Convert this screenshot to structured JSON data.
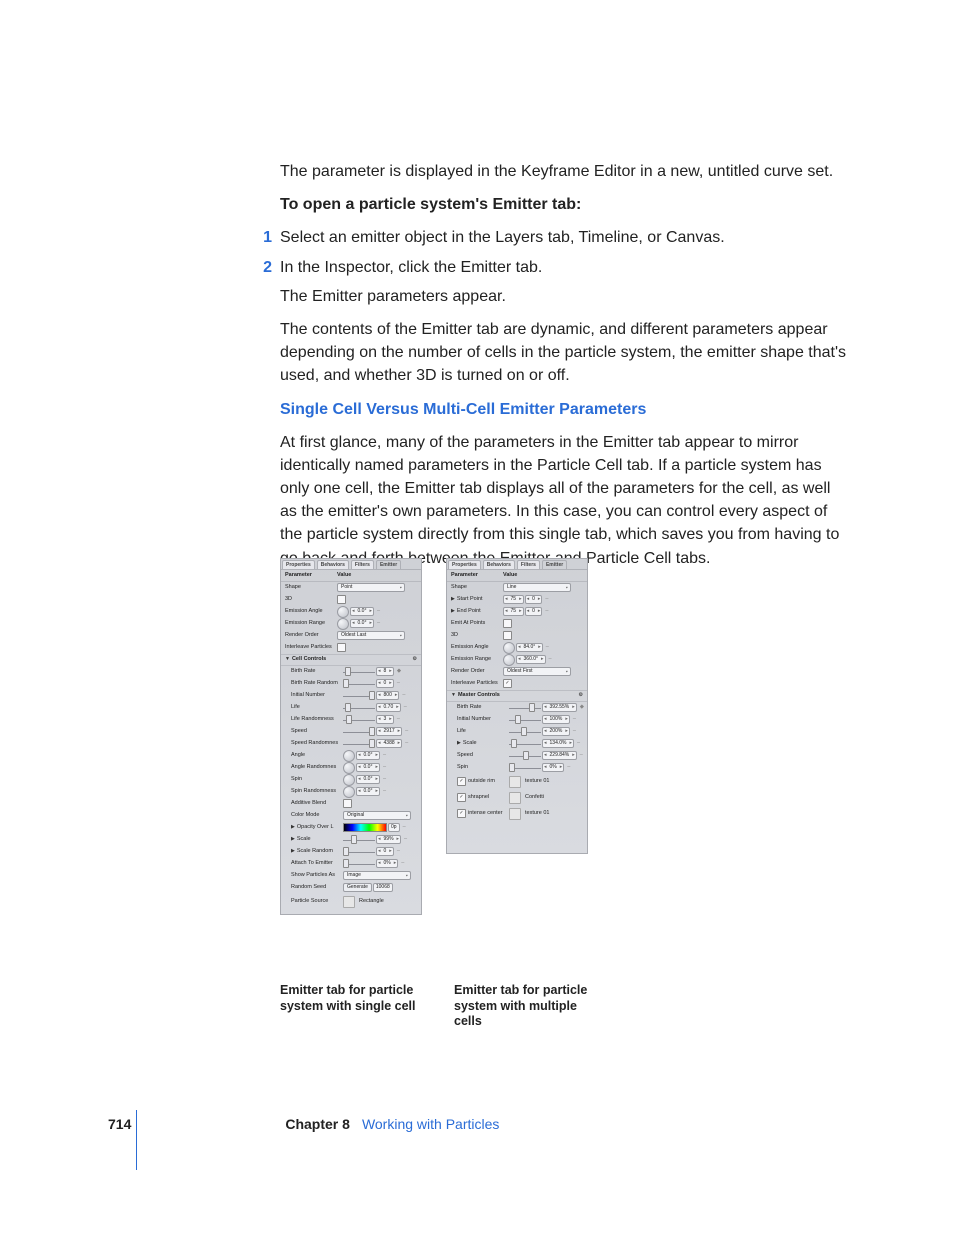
{
  "intro_para": "The parameter is displayed in the Keyframe Editor in a new, untitled curve set.",
  "heading1": "To open a particle system's Emitter tab:",
  "steps": [
    "Select an emitter object in the Layers tab, Timeline, or Canvas.",
    "In the Inspector, click the Emitter tab."
  ],
  "after_steps_1": "The Emitter parameters appear.",
  "after_steps_2": "The contents of the Emitter tab are dynamic, and different parameters appear depending on the number of cells in the particle system, the emitter shape that's used, and whether 3D is turned on or off.",
  "section_head": "Single Cell Versus Multi-Cell Emitter Parameters",
  "section_body": "At first glance, many of the parameters in the Emitter tab appear to mirror identically named parameters in the Particle Cell tab. If a particle system has only one cell, the Emitter tab displays all of the parameters for the cell, as well as the emitter's own parameters. In this case, you can control every aspect of the particle system directly from this single tab, which saves you from having to go back and forth between the Emitter and Particle Cell tabs.",
  "tabs": {
    "t1": "Properties",
    "t2": "Behaviors",
    "t3": "Filters",
    "t4": "Emitter"
  },
  "hdr": {
    "param": "Parameter",
    "value": "Value"
  },
  "single": {
    "shape_label": "Shape",
    "shape_val": "Point",
    "three_d": "3D",
    "emis_angle": "Emission Angle",
    "emis_angle_val": "0.0°",
    "emis_range": "Emission Range",
    "emis_range_val": "0.0°",
    "render": "Render Order",
    "render_val": "Oldest Last",
    "inter": "Interleave Particles",
    "group": "Cell Controls",
    "birth": "Birth Rate",
    "birth_val": "8",
    "birth_rand": "Birth Rate Random",
    "birth_rand_val": "0",
    "init": "Initial Number",
    "init_val": "800",
    "life": "Life",
    "life_val": "0.70",
    "life_rand": "Life Randomness",
    "life_rand_val": "3",
    "speed": "Speed",
    "speed_val": "2917",
    "speed_rand": "Speed Randomnes",
    "speed_rand_val": "4388",
    "angle": "Angle",
    "angle_val": "0.0°",
    "angle_rand": "Angle Randomnes",
    "angle_rand_val": "0.0°",
    "spin": "Spin",
    "spin_val": "0.0°",
    "spin_rand": "Spin Randomness",
    "spin_rand_val": "0.0°",
    "additive": "Additive Blend",
    "color_mode": "Color Mode",
    "color_mode_val": "Original",
    "opacity": "Opacity Over L",
    "opacity_val": "0p",
    "scale": "Scale",
    "scale_val": "99%",
    "scale_rand": "Scale Random",
    "scale_rand_val": "0",
    "attach": "Attach To Emitter",
    "attach_val": "0%",
    "show": "Show Particles As",
    "show_val": "Image",
    "seed": "Random Seed",
    "seed_btn": "Generate",
    "seed_val": "10068",
    "psource": "Particle Source",
    "psource_val": "Rectangle"
  },
  "multi": {
    "shape_label": "Shape",
    "shape_val": "Line",
    "start": "Start Point",
    "start_x": "75",
    "start_y": "0",
    "end": "End Point",
    "end_x": "75",
    "end_y": "0",
    "emit_pts": "Emit At Points",
    "three_d": "3D",
    "emis_angle": "Emission Angle",
    "emis_angle_val": "84.0°",
    "emis_range": "Emission Range",
    "emis_range_val": "360.0°",
    "render": "Render Order",
    "render_val": "Oldest First",
    "inter": "Interleave Particles",
    "group": "Master Controls",
    "birth": "Birth Rate",
    "birth_val": "392.55%",
    "init": "Initial Number",
    "init_val": "100%",
    "life": "Life",
    "life_val": "200%",
    "scale": "Scale",
    "scale_val": "134.0%",
    "speed": "Speed",
    "speed_val": "229.84%",
    "spin": "Spin",
    "spin_val": "0%",
    "cell1_lbl": "outside rim",
    "cell1_val": "texture 01",
    "cell2_lbl": "shrapnel",
    "cell2_val": "Confetti",
    "cell3_lbl": "intense center",
    "cell3_val": "texture 01"
  },
  "caption1": "Emitter tab for particle system with single cell",
  "caption2": "Emitter tab for particle system with multiple cells",
  "page_num": "714",
  "chapter_label": "Chapter 8",
  "chapter_title": "Working with Particles"
}
